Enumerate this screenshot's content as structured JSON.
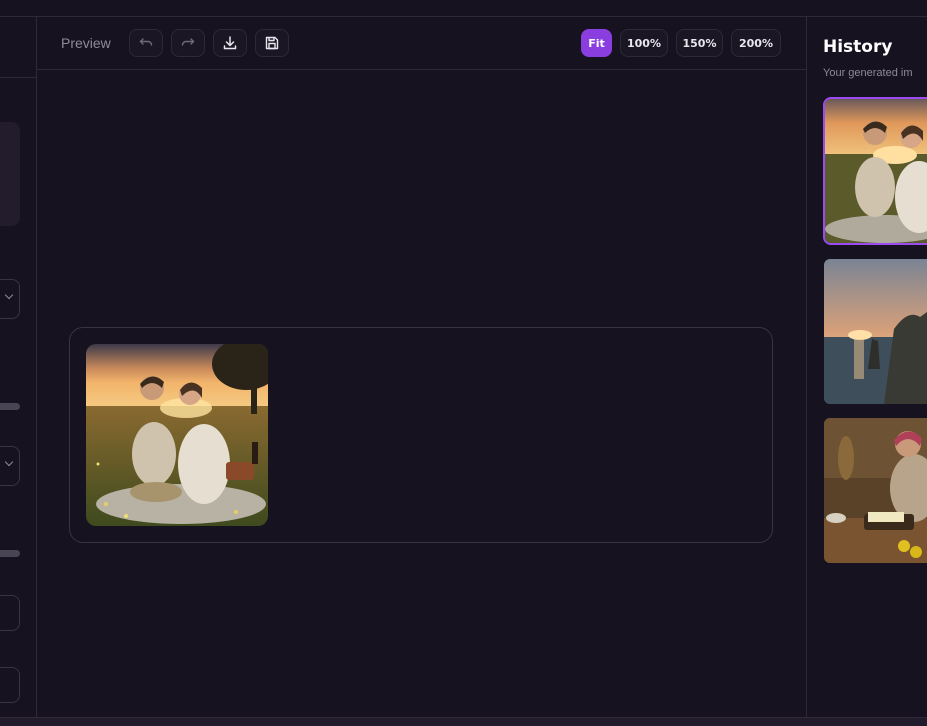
{
  "toolbar": {
    "preview_label": "Preview",
    "zoom_options": [
      "Fit",
      "100%",
      "150%",
      "200%"
    ],
    "active_zoom": "Fit",
    "icons": [
      "undo-icon",
      "redo-icon",
      "download-icon",
      "save-icon"
    ]
  },
  "history": {
    "title": "History",
    "subtitle": "Your generated im",
    "items": [
      {
        "name": "couple-sunset-picnic",
        "selected": true
      },
      {
        "name": "coastal-cliffs-sunset",
        "selected": false
      },
      {
        "name": "woman-kitchen-baking",
        "selected": false
      }
    ]
  },
  "colors": {
    "background": "#17121f",
    "accent": "#8b3ee0",
    "border": "#2e2838",
    "muted_text": "#8f8a99"
  }
}
